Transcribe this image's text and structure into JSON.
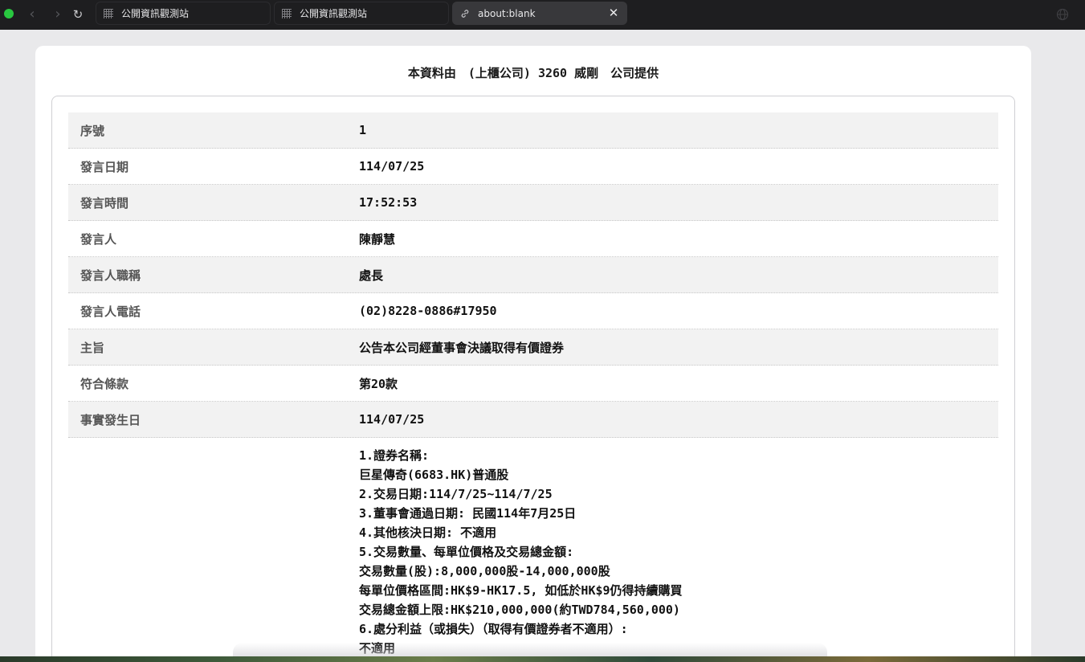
{
  "browser": {
    "tabs": [
      {
        "label": "公開資訊觀測站",
        "icon": "grid-icon",
        "active": false
      },
      {
        "label": "公開資訊觀測站",
        "icon": "grid-icon",
        "active": false
      },
      {
        "label": "about:blank",
        "icon": "link-icon",
        "active": true
      }
    ],
    "back_icon": "‹",
    "forward_icon": "›",
    "reload_icon": "↻",
    "close_icon": "✕"
  },
  "page": {
    "provider": "本資料由　(上櫃公司) 3260 威剛　公司提供",
    "rows": [
      {
        "label": "序號",
        "value": "1"
      },
      {
        "label": "發言日期",
        "value": "114/07/25"
      },
      {
        "label": "發言時間",
        "value": "17:52:53"
      },
      {
        "label": "發言人",
        "value": "陳靜慧"
      },
      {
        "label": "發言人職稱",
        "value": "處長"
      },
      {
        "label": "發言人電話",
        "value": "(02)8228-0886#17950"
      },
      {
        "label": "主旨",
        "value": "公告本公司經董事會決議取得有價證券"
      },
      {
        "label": "符合條款",
        "value": "第20款"
      },
      {
        "label": "事實發生日",
        "value": "114/07/25"
      }
    ],
    "detail_lines": [
      "1.證券名稱:",
      "巨星傳奇(6683.HK)普通股",
      "2.交易日期:114/7/25~114/7/25",
      "3.董事會通過日期: 民國114年7月25日",
      "4.其他核決日期: 不適用",
      "5.交易數量、每單位價格及交易總金額:",
      "交易數量(股):8,000,000股-14,000,000股",
      "每單位價格區間:HK$9-HK17.5, 如低於HK$9仍得持續購買",
      "交易總金額上限:HK$210,000,000(約TWD784,560,000)",
      "6.處分利益（或損失）（取得有價證券者不適用）:",
      "不適用"
    ]
  },
  "colors": {
    "chrome_bg": "#1e1e20",
    "active_tab": "#38383b",
    "traffic_green": "#29c740",
    "row_stripe": "#f2f2f2"
  }
}
